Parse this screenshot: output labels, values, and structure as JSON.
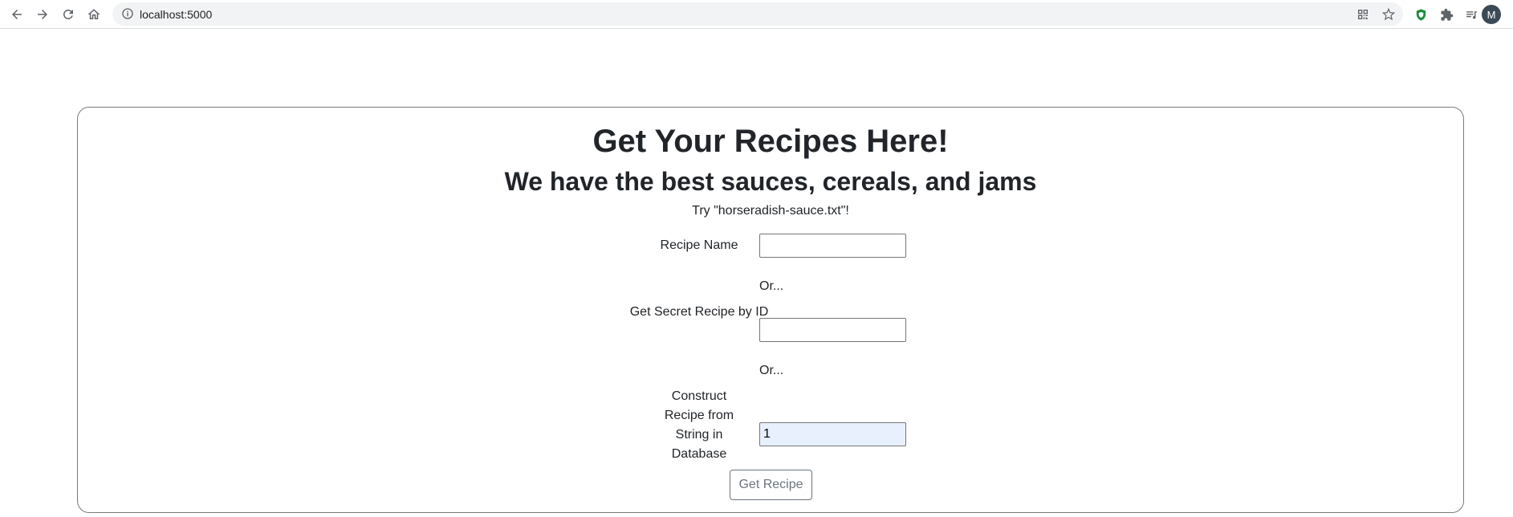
{
  "browser": {
    "url": "localhost:5000",
    "profile_initial": "M",
    "icons": [
      "back-icon",
      "forward-icon",
      "reload-icon",
      "home-icon",
      "site-info-icon",
      "qr-code-icon",
      "bookmark-star-icon",
      "shield-extension-icon",
      "puzzle-extensions-icon",
      "reading-list-icon"
    ],
    "colors": {
      "shield": "#1e8e3e",
      "avatar": "#3c4a58"
    }
  },
  "page": {
    "title": "Get Your Recipes Here!",
    "subtitle": "We have the best sauces, cereals, and jams",
    "hint": "Try \"horseradish-sauce.txt\"!",
    "form": {
      "recipe_name_label": "Recipe Name",
      "recipe_name_value": "",
      "or_1": "Or...",
      "secret_id_label": "Get Secret Recipe by ID",
      "secret_id_value": "",
      "or_2": "Or...",
      "construct_label": "Construct Recipe from String in Database",
      "construct_value": "1",
      "submit_label": "Get Recipe"
    }
  }
}
